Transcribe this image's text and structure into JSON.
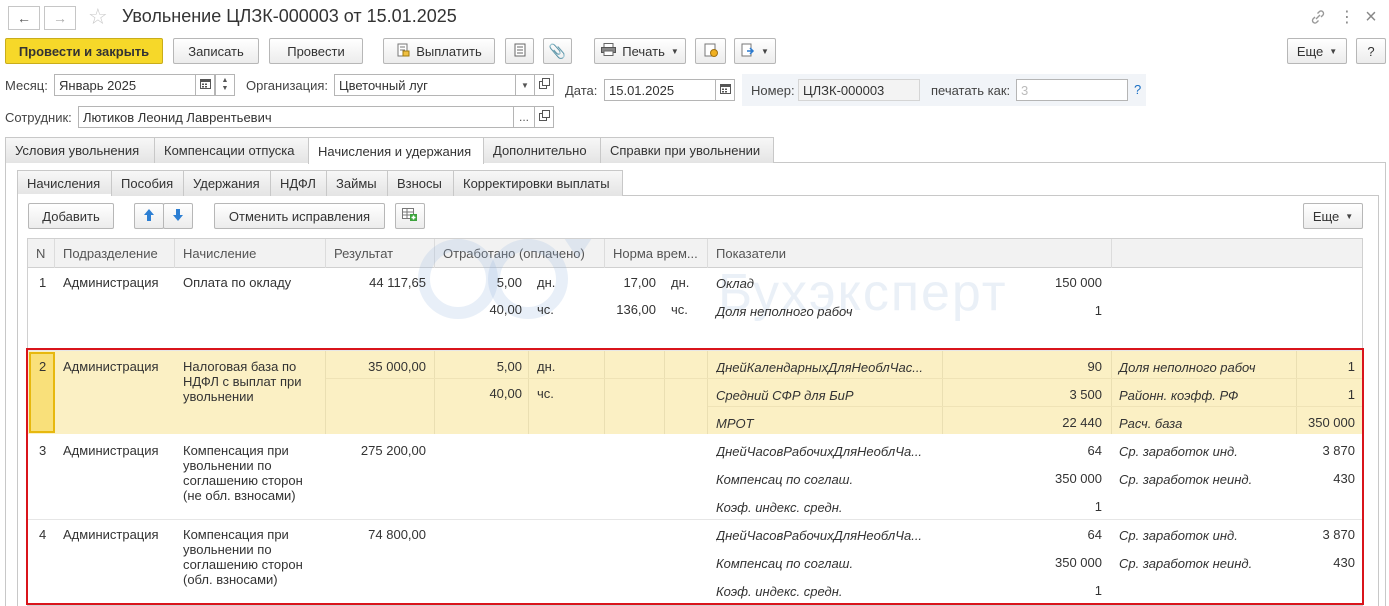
{
  "window": {
    "title": "Увольнение ЦЛЗК-000003 от 15.01.2025"
  },
  "toolbar": {
    "post_close": "Провести и закрыть",
    "save": "Записать",
    "post": "Провести",
    "pay": "Выплатить",
    "print": "Печать",
    "more": "Еще",
    "help": "?"
  },
  "form": {
    "month_label": "Месяц:",
    "month_value": "Январь 2025",
    "org_label": "Организация:",
    "org_value": "Цветочный луг",
    "date_label": "Дата:",
    "date_value": "15.01.2025",
    "number_label": "Номер:",
    "number_value": "ЦЛЗК-000003",
    "print_as_label": "печатать как:",
    "print_as_placeholder": "3",
    "help_link": "?",
    "employee_label": "Сотрудник:",
    "employee_value": "Лютиков Леонид Лаврентьевич",
    "ellipsis": "..."
  },
  "tabs": [
    "Условия увольнения",
    "Компенсации отпуска",
    "Начисления и удержания",
    "Дополнительно",
    "Справки при увольнении"
  ],
  "subtabs": [
    "Начисления",
    "Пособия",
    "Удержания",
    "НДФЛ",
    "Займы",
    "Взносы",
    "Корректировки выплаты"
  ],
  "panel_toolbar": {
    "add": "Добавить",
    "cancel_corrections": "Отменить исправления",
    "more": "Еще"
  },
  "table": {
    "columns": [
      "N",
      "Подразделение",
      "Начисление",
      "Результат",
      "Отработано (оплачено)",
      "Норма врем...",
      "Показатели"
    ],
    "rows": [
      {
        "n": "1",
        "dept": "Администрация",
        "accrual": "Оплата по окладу",
        "result": "44 117,65",
        "worked_days": "5,00",
        "worked_days_unit": "дн.",
        "worked_hours": "40,00",
        "worked_hours_unit": "чс.",
        "norm_days": "17,00",
        "norm_days_unit": "дн.",
        "norm_hours": "136,00",
        "norm_hours_unit": "чс.",
        "ind1_name": "Оклад",
        "ind1_value": "150 000",
        "ind2_name": "Доля неполного рабоч",
        "ind2_value": "1"
      },
      {
        "n": "2",
        "dept": "Администрация",
        "accrual": "Налоговая база по НДФЛ с выплат при увольнении",
        "result": "35 000,00",
        "worked_days": "5,00",
        "worked_days_unit": "дн.",
        "worked_hours": "40,00",
        "worked_hours_unit": "чс.",
        "ind1_name": "ДнейКалендарныхДляНеобл­Час...",
        "ind1_value": "90",
        "ind2_name": "Средний СФР для БиР",
        "ind2_value": "3 500",
        "ind3_name": "МРОТ",
        "ind3_value": "22 440",
        "ind4_name": "Доля неполного рабоч",
        "ind4_value": "1",
        "ind5_name": "Районн. коэфф. РФ",
        "ind5_value": "1",
        "ind6_name": "Расч. база",
        "ind6_value": "350 000"
      },
      {
        "n": "3",
        "dept": "Администрация",
        "accrual": "Компенсация при увольнении по соглашению сторон (не обл. взносами)",
        "result": "275 200,00",
        "ind1_name": "ДнейЧасовРабочихДляНеоблЧа...",
        "ind1_value": "64",
        "ind2_name": "Компенсац по соглаш.",
        "ind2_value": "350 000",
        "ind3_name": "Коэф. индекс. средн.",
        "ind3_value": "1",
        "ind4_name": "Ср. заработок инд.",
        "ind4_value": "3 870",
        "ind5_name": "Ср. заработок неинд.",
        "ind5_value": "430"
      },
      {
        "n": "4",
        "dept": "Администрация",
        "accrual": "Компенсация при увольнении по соглашению сторон (обл. взносами)",
        "result": "74 800,00",
        "ind1_name": "ДнейЧасовРабочихДляНеоблЧа...",
        "ind1_value": "64",
        "ind2_name": "Компенсац по соглаш.",
        "ind2_value": "350 000",
        "ind3_name": "Коэф. индекс. средн.",
        "ind3_value": "1",
        "ind4_name": "Ср. заработок инд.",
        "ind4_value": "3 870",
        "ind5_name": "Ср. заработок неинд.",
        "ind5_value": "430"
      }
    ]
  },
  "watermark": "Бухэксперт",
  "colors": {
    "primary_button": "#f6d829",
    "selected_row": "#fbf0c4",
    "highlight_box": "#d9141b",
    "link": "#1a6fc4"
  }
}
